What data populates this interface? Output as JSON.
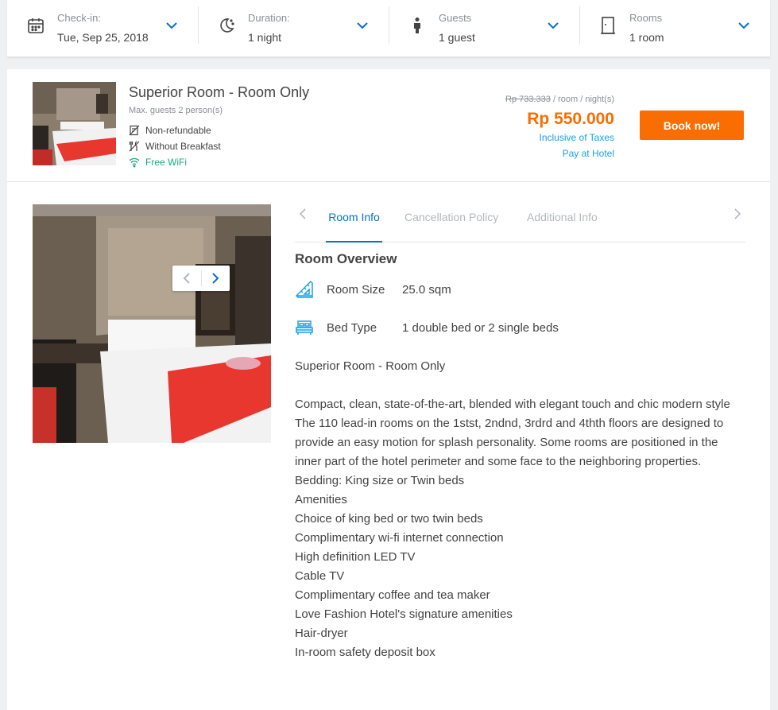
{
  "search": {
    "checkin": {
      "label": "Check-in:",
      "value": "Tue, Sep 25, 2018",
      "icon": "calendar-icon"
    },
    "duration": {
      "label": "Duration:",
      "value": "1 night",
      "icon": "moon-icon"
    },
    "guests": {
      "label": "Guests",
      "value": "1 guest",
      "icon": "person-icon"
    },
    "rooms": {
      "label": "Rooms",
      "value": "1 room",
      "icon": "door-icon"
    }
  },
  "room": {
    "title": "Superior Room - Room Only",
    "max_guests": "Max. guests 2 person(s)",
    "features": [
      "Non-refundable",
      "Without Breakfast",
      "Free WiFi"
    ],
    "original_price": "Rp 733.333",
    "price_unit": " / room / night(s)",
    "price": "Rp 550.000",
    "tax_note": "Inclusive of Taxes",
    "pay_note": "Pay at Hotel",
    "book_label": "Book now!"
  },
  "tabs": [
    "Room Info",
    "Cancellation Policy",
    "Additional Info"
  ],
  "overview": {
    "title": "Room Overview",
    "room_size": {
      "name": "Room Size",
      "value": "25.0 sqm"
    },
    "bed_type": {
      "name": "Bed Type",
      "value": "1 double bed or 2 single beds"
    },
    "description": [
      "Superior Room - Room Only",
      "",
      "Compact, clean, state-of-the-art, blended with elegant touch and chic modern style",
      "The 110 lead-in rooms on the 1stst, 2ndnd, 3rdrd and 4thth floors are designed to provide an easy motion for splash personality. Some rooms are positioned in the inner part of the hotel perimeter and some face to the neighboring properties.",
      "Bedding: King size or Twin beds",
      "Amenities",
      "Choice of king bed or two twin beds",
      "Complimentary wi-fi internet connection",
      "High definition LED TV",
      "Cable TV",
      "Complimentary coffee and tea maker",
      "Love Fashion Hotel's signature amenities",
      "Hair-dryer",
      "In-room safety deposit box"
    ]
  },
  "colors": {
    "accent": "#f96d01",
    "link": "#1ba0e2",
    "tab_active": "#0770cd",
    "icon_blue": "#1ba0e2",
    "wifi_green": "#1ba97a"
  }
}
